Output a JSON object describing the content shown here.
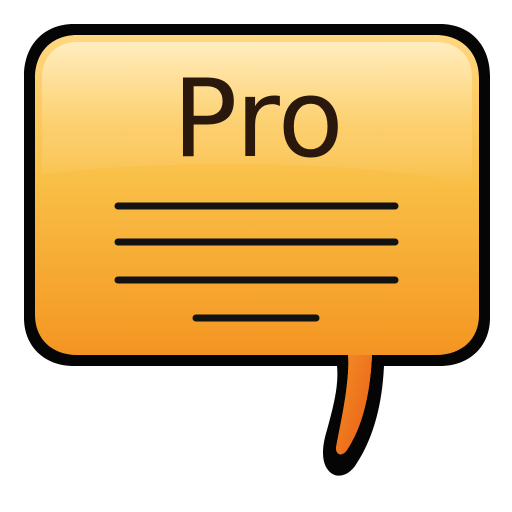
{
  "icon": {
    "name": "speech-bubble-pro-icon",
    "label": "Pro",
    "text_lines": 4
  },
  "colors": {
    "outline": "#050505",
    "top": "#ffd27a",
    "middle": "#f7b236",
    "bottom": "#ee6d1a",
    "line": "#121212",
    "text": "#2a180c"
  }
}
